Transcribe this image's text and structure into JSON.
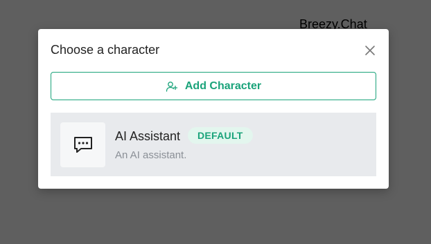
{
  "background": {
    "app_title": "Breezy.Chat"
  },
  "modal": {
    "title": "Choose a character",
    "close_icon": "close-icon",
    "add_button": {
      "label": "Add Character",
      "icon": "add-user-icon"
    },
    "characters": [
      {
        "name": "AI Assistant",
        "badge": "DEFAULT",
        "description": "An AI assistant.",
        "avatar_icon": "chat-bubble-icon"
      }
    ]
  },
  "colors": {
    "overlay": "#5f5f5f",
    "accent": "#1aa37a",
    "badge_bg": "#e3f6ee",
    "card_bg": "#e8eaed"
  }
}
